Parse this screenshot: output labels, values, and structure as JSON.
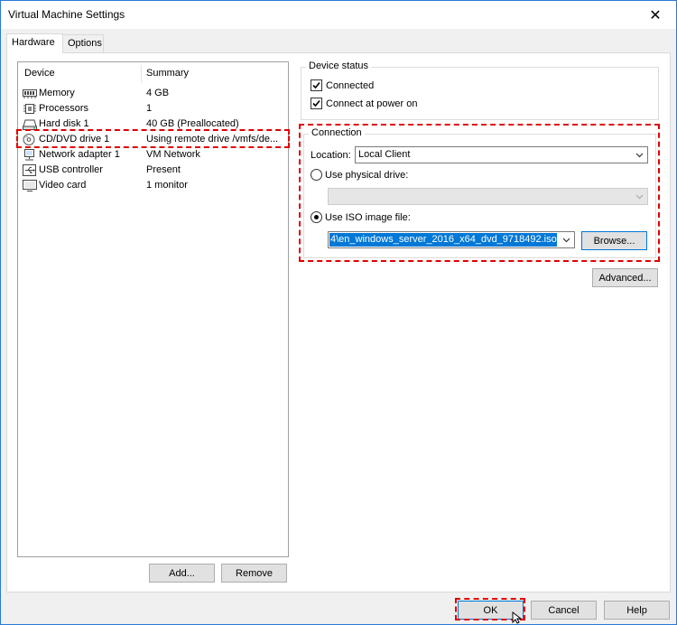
{
  "window": {
    "title": "Virtual Machine Settings",
    "close_glyph": "✕"
  },
  "tabs": [
    {
      "label": "Hardware",
      "active": true
    },
    {
      "label": "Options",
      "active": false
    }
  ],
  "device_list": {
    "columns": [
      "Device",
      "Summary"
    ],
    "rows": [
      {
        "icon": "memory-icon",
        "device": "Memory",
        "summary": "4 GB"
      },
      {
        "icon": "processor-icon",
        "device": "Processors",
        "summary": "1"
      },
      {
        "icon": "hard-disk-icon",
        "device": "Hard disk 1",
        "summary": "40 GB (Preallocated)"
      },
      {
        "icon": "cd-dvd-icon",
        "device": "CD/DVD drive 1",
        "summary": "Using remote drive /vmfs/de..."
      },
      {
        "icon": "network-adapter-icon",
        "device": "Network adapter 1",
        "summary": "VM Network"
      },
      {
        "icon": "usb-icon",
        "device": "USB controller",
        "summary": "Present"
      },
      {
        "icon": "monitor-icon",
        "device": "Video card",
        "summary": "1 monitor"
      }
    ],
    "add_label": "Add...",
    "remove_label": "Remove"
  },
  "device_status": {
    "label": "Device status",
    "connected": {
      "label": "Connected",
      "checked": true
    },
    "connect_at_power_on": {
      "label": "Connect at power on",
      "checked": true
    }
  },
  "connection": {
    "label": "Connection",
    "location_label": "Location:",
    "location_value": "Local Client",
    "physical_label": "Use physical drive:",
    "physical_selected": false,
    "iso_label": "Use ISO image file:",
    "iso_selected": true,
    "iso_value": "4\\en_windows_server_2016_x64_dvd_9718492.iso",
    "browse_label": "Browse..."
  },
  "advanced_label": "Advanced...",
  "footer": {
    "ok_label": "OK",
    "cancel_label": "Cancel",
    "help_label": "Help"
  },
  "highlight_color": "#e00000",
  "selection_color": "#0078d7"
}
